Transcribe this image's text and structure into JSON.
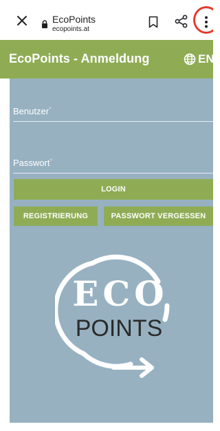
{
  "browser": {
    "page_title": "EcoPoints",
    "url": "ecopoints.at",
    "icons": [
      "close-icon",
      "lock-icon",
      "bookmark-icon",
      "share-icon",
      "more-vert-icon"
    ],
    "highlight_color": "#e53a2c"
  },
  "header": {
    "title": "EcoPoints - Anmeldung",
    "language": "EN",
    "language_icon": "globe-icon",
    "color": "#8fac55"
  },
  "form": {
    "username_label": "Benutzer",
    "password_label": "Passwort",
    "required_mark": "*",
    "login_label": "LOGIN",
    "register_label": "REGISTRIERUNG",
    "forgot_label": "PASSWORT VERGESSEN",
    "background": "#97b1c1"
  },
  "logo": {
    "line1": "ECO",
    "line2": "POINTS"
  }
}
